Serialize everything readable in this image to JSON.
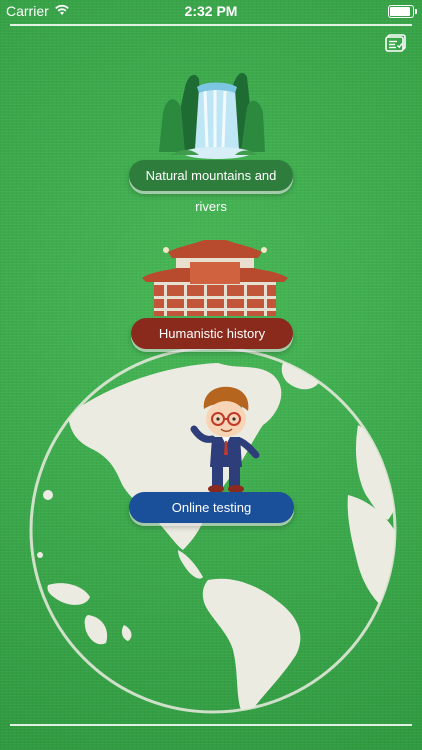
{
  "status_bar": {
    "carrier": "Carrier",
    "time": "2:32 PM",
    "battery_level": 1.0
  },
  "icons": {
    "menu": "menu-list-icon",
    "wifi": "wifi-icon",
    "battery": "battery-icon",
    "waterfall": "waterfall-illustration",
    "temple": "temple-illustration",
    "boy": "boy-character-illustration",
    "globe": "world-globe-illustration"
  },
  "menu": {
    "nature_label": "Natural mountains and rivers",
    "history_label": "Humanistic history",
    "test_label": "Online testing"
  },
  "colors": {
    "background": "#3aa84a",
    "nature_button": "#2e7d3d",
    "history_button": "#8a2a1d",
    "test_button": "#1a4f9a"
  }
}
